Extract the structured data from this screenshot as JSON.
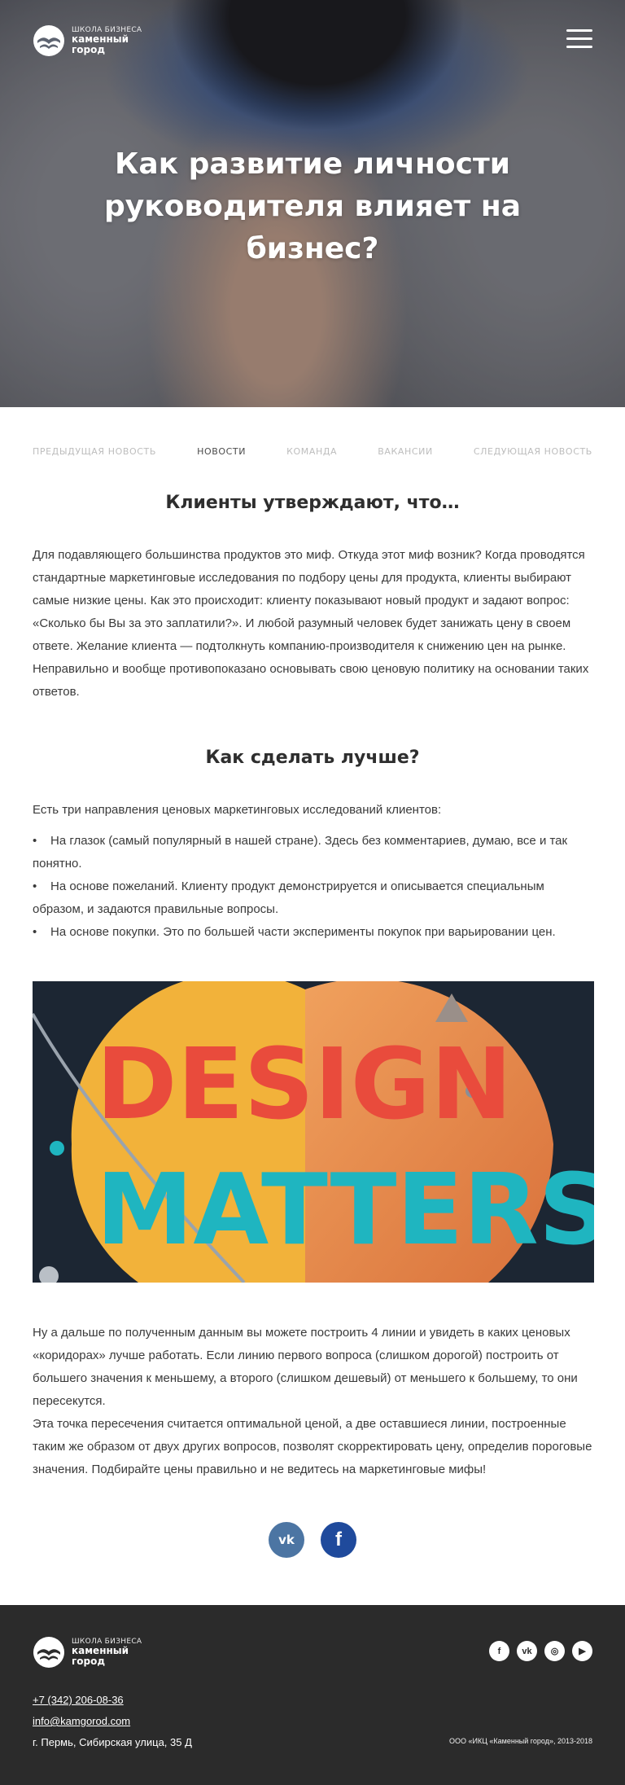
{
  "header": {
    "logo_small": "ШКОЛА БИЗНЕСА",
    "logo_big1": "каменный",
    "logo_big2": "город",
    "menu_icon": "hamburger-icon"
  },
  "hero": {
    "title": "Как развитие личности руководителя влияет на бизнес?"
  },
  "nav": {
    "items": [
      {
        "label": "ПРЕДЫДУЩАЯ НОВОСТЬ"
      },
      {
        "label": "НОВОСТИ"
      },
      {
        "label": "КОМАНДА"
      },
      {
        "label": "ВАКАНСИИ"
      },
      {
        "label": "СЛЕДУЮЩАЯ НОВОСТЬ"
      }
    ]
  },
  "article": {
    "heading1": "Клиенты утверждают, что…",
    "paragraph1": "Для подавляющего большинства продуктов это миф. Откуда этот миф возник? Когда проводятся стандартные маркетинговые исследования по подбору цены для продукта, клиенты выбирают самые низкие цены. Как это происходит: клиенту показывают новый продукт и задают вопрос: «Сколько бы Вы за это заплатили?». И любой разумный человек будет занижать цену в своем ответе. Желание клиента — подтолкнуть компанию-производителя к снижению цен на рынке. Неправильно и вообще противопоказано основывать свою ценовую политику на основании таких ответов.",
    "heading2": "Как сделать лучше?",
    "intro": "Есть три направления ценовых маркетинговых исследований клиентов:",
    "bullets": [
      "На глазок (самый популярный в нашей стране). Здесь без комментариев, думаю, все и так понятно.",
      "На основе пожеланий. Клиенту продукт демонстрируется и описывается специальным образом, и задаются правильные вопросы.",
      "На основе покупки. Это по большей части эксперименты покупок при варьировании цен."
    ],
    "image_text1": "DESIGN",
    "image_text2": "MATTERS",
    "paragraph2": "Ну а дальше по полученным данным вы можете построить 4 линии и увидеть в каких ценовых «коридорах» лучше работать. Если линию первого вопроса (слишком дорогой) построить от большего значения к меньшему, а второго (слишком дешевый) от меньшего к большему, то они пересекутся.",
    "paragraph3": "Эта точка пересечения считается оптимальной ценой, а две оставшиеся линии, построенные таким же образом от двух других вопросов, позволят скорректировать цену, определив пороговые значения. Подбирайте цены правильно и не ведитесь на маркетинговые мифы!"
  },
  "share": {
    "vk_label": "vk",
    "fb_label": "f"
  },
  "footer": {
    "logo_small": "ШКОЛА БИЗНЕСА",
    "logo_big1": "каменный",
    "logo_big2": "город",
    "phone": "+7 (342) 206-08-36",
    "email": "info@kamgorod.com",
    "address": "г. Пермь, Сибирская улица, 35 Д",
    "copyright": "ООО «ИКЦ «Каменный город», 2013-2018",
    "social": [
      {
        "icon": "facebook-icon",
        "glyph": "f"
      },
      {
        "icon": "vk-icon",
        "glyph": "vk"
      },
      {
        "icon": "instagram-icon",
        "glyph": "◎"
      },
      {
        "icon": "youtube-icon",
        "glyph": "▶"
      }
    ]
  }
}
